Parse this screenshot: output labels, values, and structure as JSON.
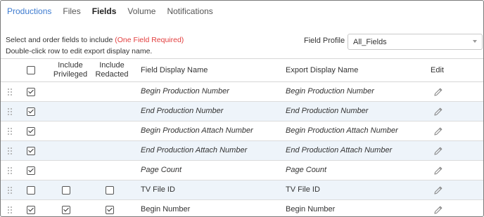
{
  "tabs": [
    {
      "label": "Productions"
    },
    {
      "label": "Files"
    },
    {
      "label": "Fields"
    },
    {
      "label": "Volume"
    },
    {
      "label": "Notifications"
    }
  ],
  "instructions": {
    "line1": "Select and order fields to include ",
    "required": "(One Field Required)",
    "line2": "Double-click row to edit export display name."
  },
  "field_profile": {
    "label": "Field Profile",
    "value": "All_Fields"
  },
  "columns": {
    "include_privileged_1": "Include",
    "include_privileged_2": "Privileged",
    "include_redacted_1": "Include",
    "include_redacted_2": "Redacted",
    "field_display_name": "Field Display Name",
    "export_display_name": "Export Display Name",
    "edit": "Edit"
  },
  "header_select_all_checked": false,
  "rows": [
    {
      "checked": true,
      "privileged": null,
      "redacted": null,
      "field": "Begin Production Number",
      "export": "Begin Production Number",
      "italic": true
    },
    {
      "checked": true,
      "privileged": null,
      "redacted": null,
      "field": "End Production Number",
      "export": "End Production Number",
      "italic": true
    },
    {
      "checked": true,
      "privileged": null,
      "redacted": null,
      "field": "Begin Production Attach Number",
      "export": "Begin Production Attach Number",
      "italic": true
    },
    {
      "checked": true,
      "privileged": null,
      "redacted": null,
      "field": "End Production Attach Number",
      "export": "End Production Attach Number",
      "italic": true
    },
    {
      "checked": true,
      "privileged": null,
      "redacted": null,
      "field": "Page Count",
      "export": "Page Count",
      "italic": true
    },
    {
      "checked": false,
      "privileged": false,
      "redacted": false,
      "field": "TV File ID",
      "export": "TV File ID",
      "italic": false
    },
    {
      "checked": true,
      "privileged": true,
      "redacted": true,
      "field": "Begin Number",
      "export": "Begin Number",
      "italic": false
    }
  ],
  "icons": {
    "drag": "drag-handle-icon",
    "edit": "pencil-icon"
  },
  "colors": {
    "active_tab": "#3d7bd0",
    "required": "#e23d3d",
    "row_alt": "#eef4fa"
  }
}
